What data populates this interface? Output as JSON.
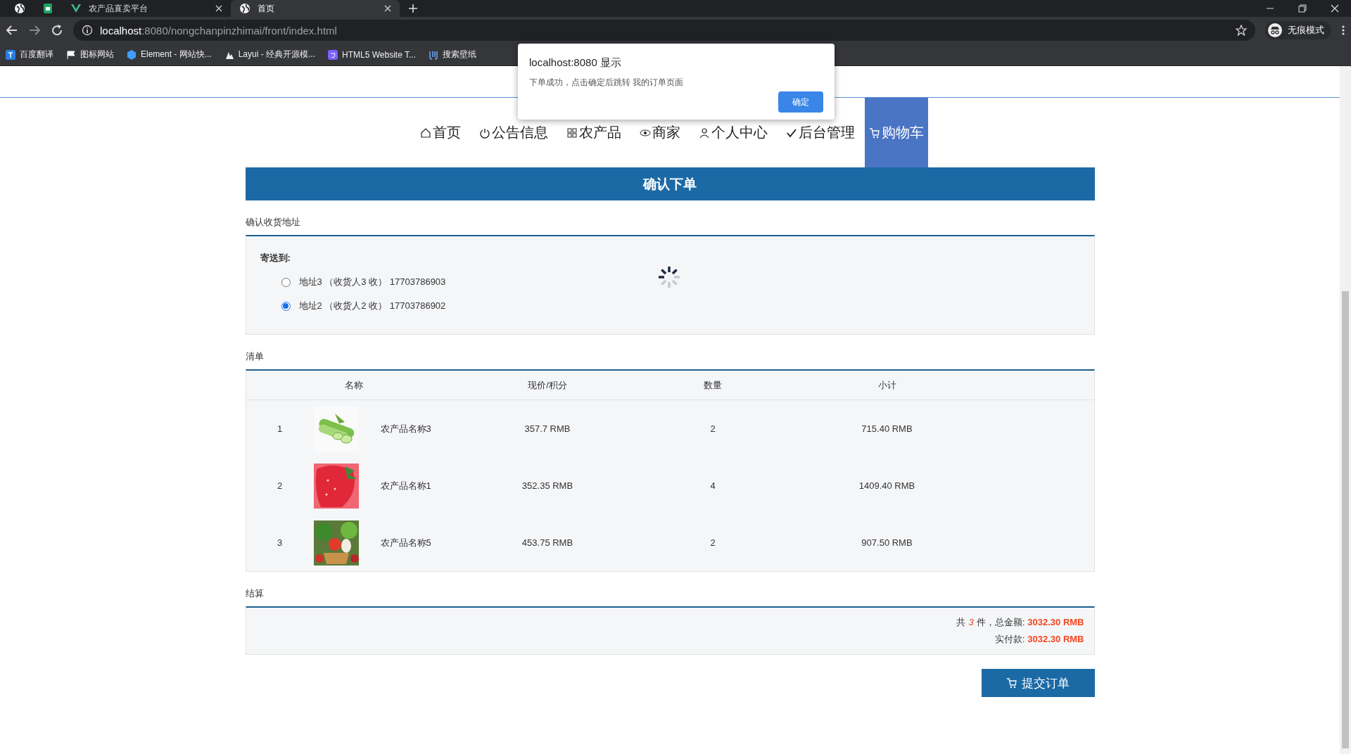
{
  "browser": {
    "tabs": [
      {
        "kind": "globe",
        "selected": false
      },
      {
        "kind": "sheet",
        "selected": false
      },
      {
        "kind": "vue",
        "title": "农产品直卖平台",
        "selected": false
      },
      {
        "kind": "globe",
        "title": "首页",
        "selected": true
      }
    ],
    "url_host": "localhost",
    "url_rest": ":8080/nongchanpinzhimai/front/index.html",
    "bookmarks": [
      {
        "kind": "translate",
        "label": "百度翻译"
      },
      {
        "kind": "flag",
        "label": "图标网站"
      },
      {
        "kind": "hex",
        "label": "Element - 网站快..."
      },
      {
        "kind": "layui",
        "label": "Layui - 经典开源模..."
      },
      {
        "kind": "html5",
        "label": "HTML5 Website T..."
      },
      {
        "kind": "wallpaper",
        "label": "搜索壁纸"
      }
    ],
    "profile_label": "无痕模式"
  },
  "dialog": {
    "title": "localhost:8080 显示",
    "message": "下单成功，点击确定后跳转 我的订单页面",
    "button": "确定"
  },
  "nav": {
    "items": [
      {
        "kind": "home",
        "label": "首页",
        "selected": false
      },
      {
        "kind": "clock",
        "label": "公告信息",
        "selected": false
      },
      {
        "kind": "grid",
        "label": "农产品",
        "selected": false
      },
      {
        "kind": "shop",
        "label": "商家",
        "selected": false
      },
      {
        "kind": "user",
        "label": "个人中心",
        "selected": false
      },
      {
        "kind": "check",
        "label": "后台管理",
        "selected": false
      },
      {
        "kind": "cart",
        "label": "购物车",
        "selected": true
      }
    ]
  },
  "banner": {
    "title": "确认下单"
  },
  "address": {
    "heading": "确认收货地址",
    "label": "寄送到:",
    "options": [
      {
        "text": "地址3 （收货人3 收） 17703786903",
        "selected": false
      },
      {
        "text": "地址2 （收货人2 收） 17703786902",
        "selected": true
      }
    ]
  },
  "list": {
    "heading": "清单",
    "columns": [
      "名称",
      "现价/积分",
      "数量",
      "小计"
    ],
    "rows": [
      {
        "index": "1",
        "name": "农产品名称3",
        "price": "357.7 RMB",
        "quantity": "2",
        "subtotal": "715.40 RMB"
      },
      {
        "index": "2",
        "name": "农产品名称1",
        "price": "352.35 RMB",
        "quantity": "4",
        "subtotal": "1409.40 RMB"
      },
      {
        "index": "3",
        "name": "农产品名称5",
        "price": "453.75 RMB",
        "quantity": "2",
        "subtotal": "907.50 RMB"
      }
    ]
  },
  "settle": {
    "heading": "结算",
    "count_prefix": "共",
    "count": "3",
    "count_suffix": "件，总金额:",
    "total": "3032.30 RMB",
    "paid_label": "实付款:",
    "paid": "3032.30 RMB"
  },
  "submit_button": "提交订单"
}
